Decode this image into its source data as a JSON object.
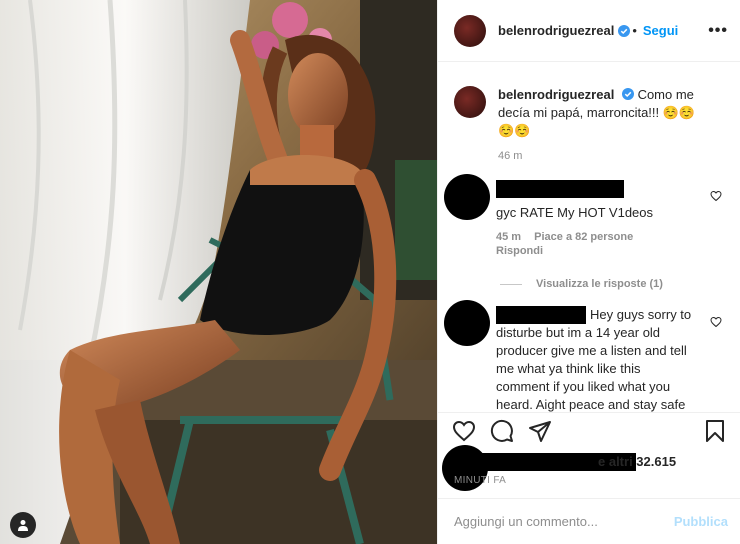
{
  "post": {
    "username": "belenrodriguezreal",
    "follow_label": "Segui",
    "more_label": "•••",
    "caption": "Como me decía mi papá, marroncita!!! ☺️☺️☺️☺️",
    "caption_time": "46 m"
  },
  "comments": [
    {
      "text": "gyc RATE My HOT V1deos",
      "time": "45 m",
      "likes": "Piace a 82 persone",
      "reply_label": "Rispondi",
      "view_replies": "Visualizza le risposte (1)"
    },
    {
      "text": "Hey guys sorry to disturbe but im a 14 year old producer give me a listen and tell me what ya think like this comment if you liked what you heard. Aight peace and stay safe"
    }
  ],
  "likes_text": "e altri 32.615",
  "posted_ago": "MINUTI FA",
  "comment_box": {
    "placeholder": "Aggiungi un commento...",
    "publish_label": "Pubblica"
  },
  "colors": {
    "accent": "#0095f6",
    "publish_disabled": "#b2dffc",
    "secondary_text": "#8e8e8e"
  }
}
